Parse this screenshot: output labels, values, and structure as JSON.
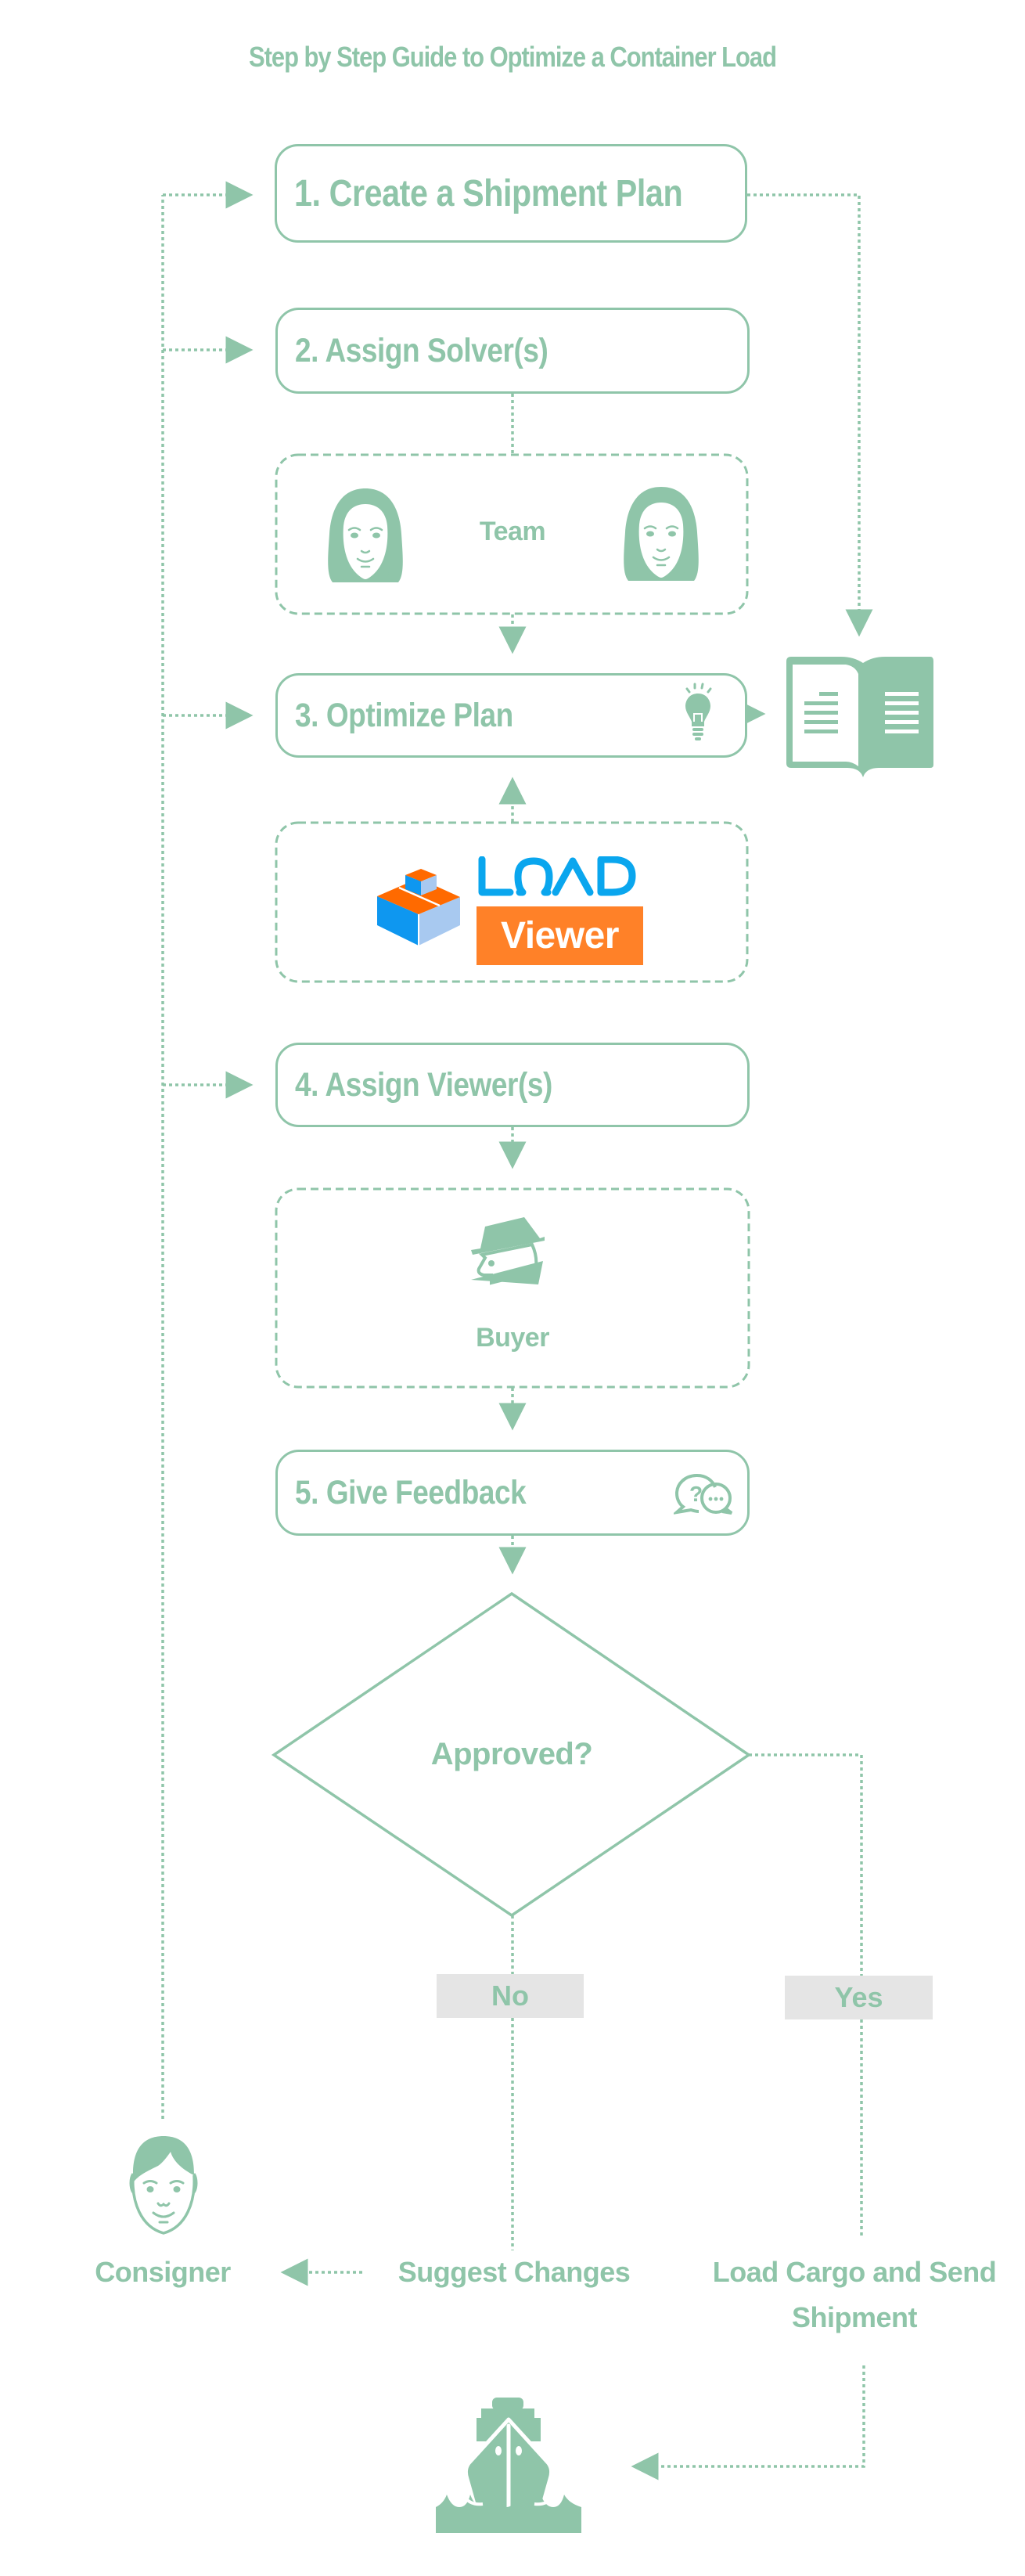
{
  "title": "Step by Step Guide to Optimize a Container Load",
  "steps": [
    {
      "label": "1. Create a Shipment Plan"
    },
    {
      "label": "2. Assign Solver(s)"
    },
    {
      "label": "3. Optimize Plan",
      "icon": "lightbulb-icon"
    },
    {
      "label": "4. Assign Viewer(s)"
    },
    {
      "label": "5. Give Feedback",
      "icon": "chat-bubbles-icon"
    }
  ],
  "groups": {
    "team": {
      "label": "Team",
      "icons": [
        "woman-face-icon",
        "woman-face-icon"
      ]
    },
    "logo": {
      "brand_top": "LOAD",
      "brand_bottom": "Viewer",
      "icon": "load-viewer-cube-logo"
    },
    "buyer": {
      "label": "Buyer",
      "icon": "spy-buyer-icon"
    }
  },
  "decision": {
    "question": "Approved?",
    "no_label": "No",
    "yes_label": "Yes"
  },
  "outcomes": {
    "consigner": "Consigner",
    "suggest_changes": "Suggest Changes",
    "load_cargo_line1": "Load Cargo and Send",
    "load_cargo_line2": "Shipment"
  },
  "side_icons": {
    "plan_document": "open-book-document-icon",
    "ship": "cargo-ship-icon",
    "consigner": "man-face-icon"
  },
  "colors": {
    "primary": "#8fc5a9",
    "tag_bg": "#e5e5e5",
    "logo_blue": "#0aa6ee",
    "logo_orange": "#ff8128",
    "logo_light_blue": "#a8c9f0"
  }
}
